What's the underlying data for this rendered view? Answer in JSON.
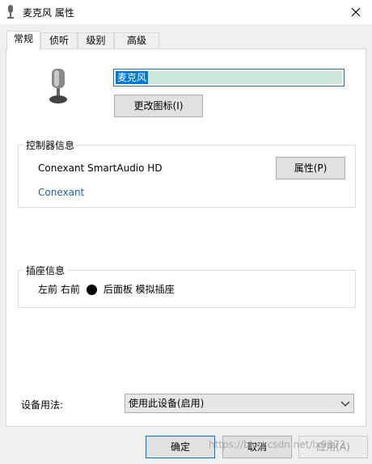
{
  "window": {
    "title": "麦克风 属性"
  },
  "tabs": [
    {
      "label": "常规"
    },
    {
      "label": "侦听"
    },
    {
      "label": "级别"
    },
    {
      "label": "高级"
    }
  ],
  "general": {
    "device_name": "麦克风",
    "change_icon_label": "更改图标(I)",
    "controller_group_label": "控制器信息",
    "controller_name": "Conexant SmartAudio HD",
    "controller_vendor_link": "Conexant",
    "properties_button": "属性(P)",
    "jack_group_label": "插座信息",
    "jack_position": "左前 右前",
    "jack_description": "后面板 模拟插座",
    "jack_color": "#000000",
    "device_usage_label": "设备用法:",
    "device_usage_value": "使用此设备(启用)"
  },
  "footer": {
    "ok_label": "确定",
    "cancel_label": "取消",
    "apply_label": "应用(A)"
  },
  "watermark": "https://blog.csdn.net/lx9372",
  "colors": {
    "accent": "#0078d7",
    "link": "#1e5fa8",
    "input_fill": "#cde8d6"
  }
}
